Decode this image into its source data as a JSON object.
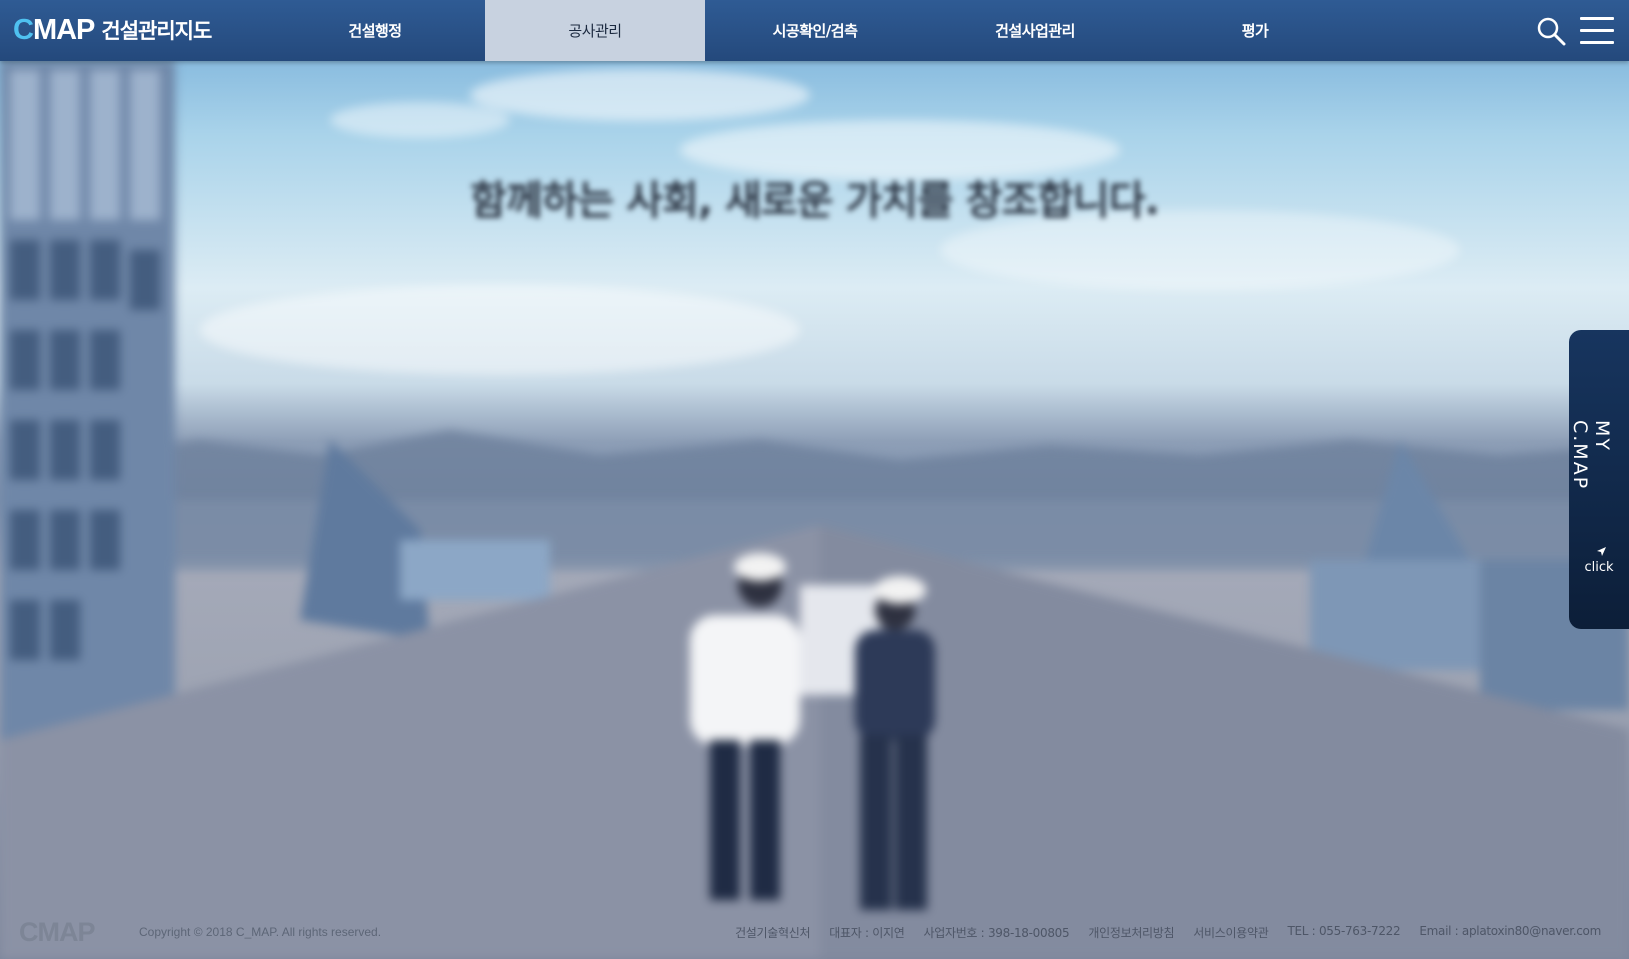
{
  "header": {
    "logo_mark_c": "C",
    "logo_mark_rest": "MAP",
    "logo_text": "건설관리지도",
    "nav": [
      {
        "label": "건설행정"
      },
      {
        "label": "공사관리"
      },
      {
        "label": "시공확인/검측"
      },
      {
        "label": "건설사업관리"
      },
      {
        "label": "평가"
      }
    ],
    "active_nav": "공사관리",
    "icons": [
      "search-icon",
      "hamburger-menu-icon"
    ]
  },
  "hero": {
    "title": "함께하는 사회, 새로운 가치를 창조합니다.",
    "subtitle_line1": "",
    "subtitle_line2": ""
  },
  "side_tab": {
    "label": "MY C.MAP",
    "click": "click"
  },
  "footer": {
    "logo": "CMAP",
    "copyright": "Copyright © 2018 C_MAP. All rights reserved.",
    "links": [
      "건설기술혁신처",
      "대표자 : 이지연",
      "사업자번호 : 398-18-00805",
      "개인정보처리방침",
      "서비스이용약관",
      "TEL : 055-763-7222",
      "Email : aplatoxin80@naver.com"
    ]
  },
  "colors": {
    "nav_bg": "#2a528a",
    "nav_active_bg": "#c8d2e0",
    "logo_accent": "#4fc1f0",
    "side_tab_bg": "#0f2747"
  }
}
